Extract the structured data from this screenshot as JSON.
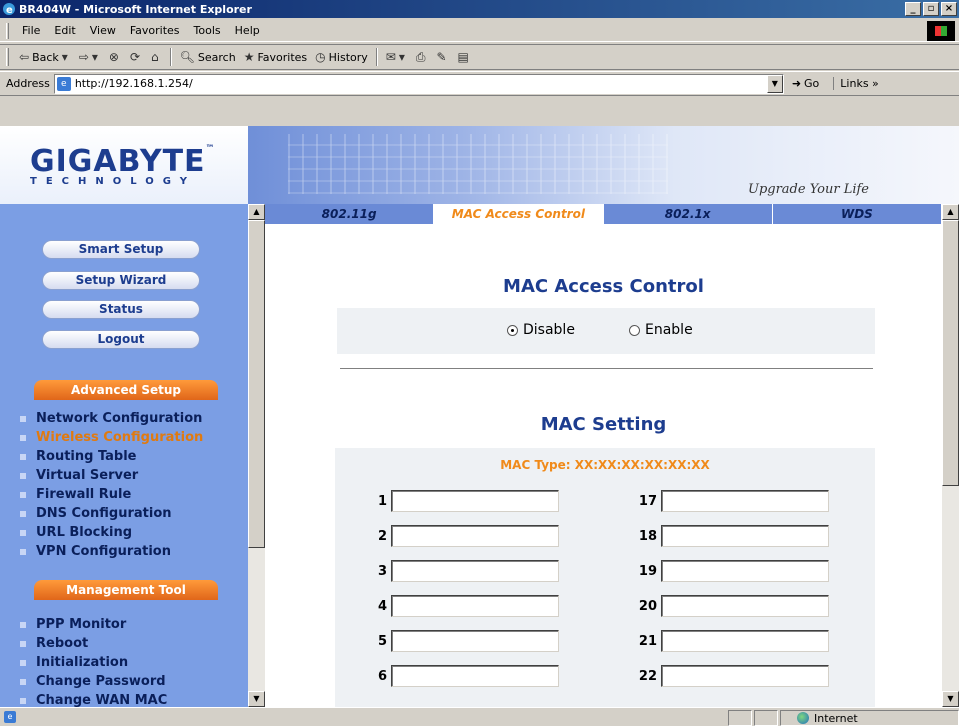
{
  "window": {
    "title": "BR404W - Microsoft Internet Explorer"
  },
  "menu": [
    "File",
    "Edit",
    "View",
    "Favorites",
    "Tools",
    "Help"
  ],
  "toolbar": {
    "back": "Back",
    "search": "Search",
    "favorites": "Favorites",
    "history": "History"
  },
  "address": {
    "label": "Address",
    "url": "http://192.168.1.254/",
    "go": "Go",
    "links": "Links"
  },
  "brand": {
    "name": "GIGABYTE",
    "sub": "TECHNOLOGY",
    "tm": "™",
    "slogan": "Upgrade Your Life"
  },
  "nav": {
    "buttons": [
      "Smart Setup",
      "Setup Wizard",
      "Status",
      "Logout"
    ],
    "advanced_header": "Advanced Setup",
    "advanced_items": [
      "Network Configuration",
      "Wireless Configuration",
      "Routing Table",
      "Virtual Server",
      "Firewall Rule",
      "DNS Configuration",
      "URL Blocking",
      "VPN Configuration"
    ],
    "management_header": "Management Tool",
    "management_items": [
      "PPP Monitor",
      "Reboot",
      "Initialization",
      "Change Password",
      "Change WAN MAC"
    ]
  },
  "tabs": [
    "802.11g",
    "MAC Access Control",
    "802.1x",
    "WDS"
  ],
  "active_tab": "MAC Access Control",
  "main": {
    "heading": "MAC Access Control",
    "radio_disable": "Disable",
    "radio_enable": "Enable",
    "selected": "Disable",
    "mac_heading": "MAC Setting",
    "mac_type": "MAC Type: XX:XX:XX:XX:XX:XX",
    "left_nums": [
      "1",
      "2",
      "3",
      "4",
      "5",
      "6"
    ],
    "right_nums": [
      "17",
      "18",
      "19",
      "20",
      "21",
      "22"
    ]
  },
  "status": {
    "zone": "Internet"
  },
  "colors": {
    "accent": "#f08a1a",
    "nav_bg": "#7b9ee4",
    "brand": "#1d3d8f",
    "titlebar": "#0a246a"
  }
}
